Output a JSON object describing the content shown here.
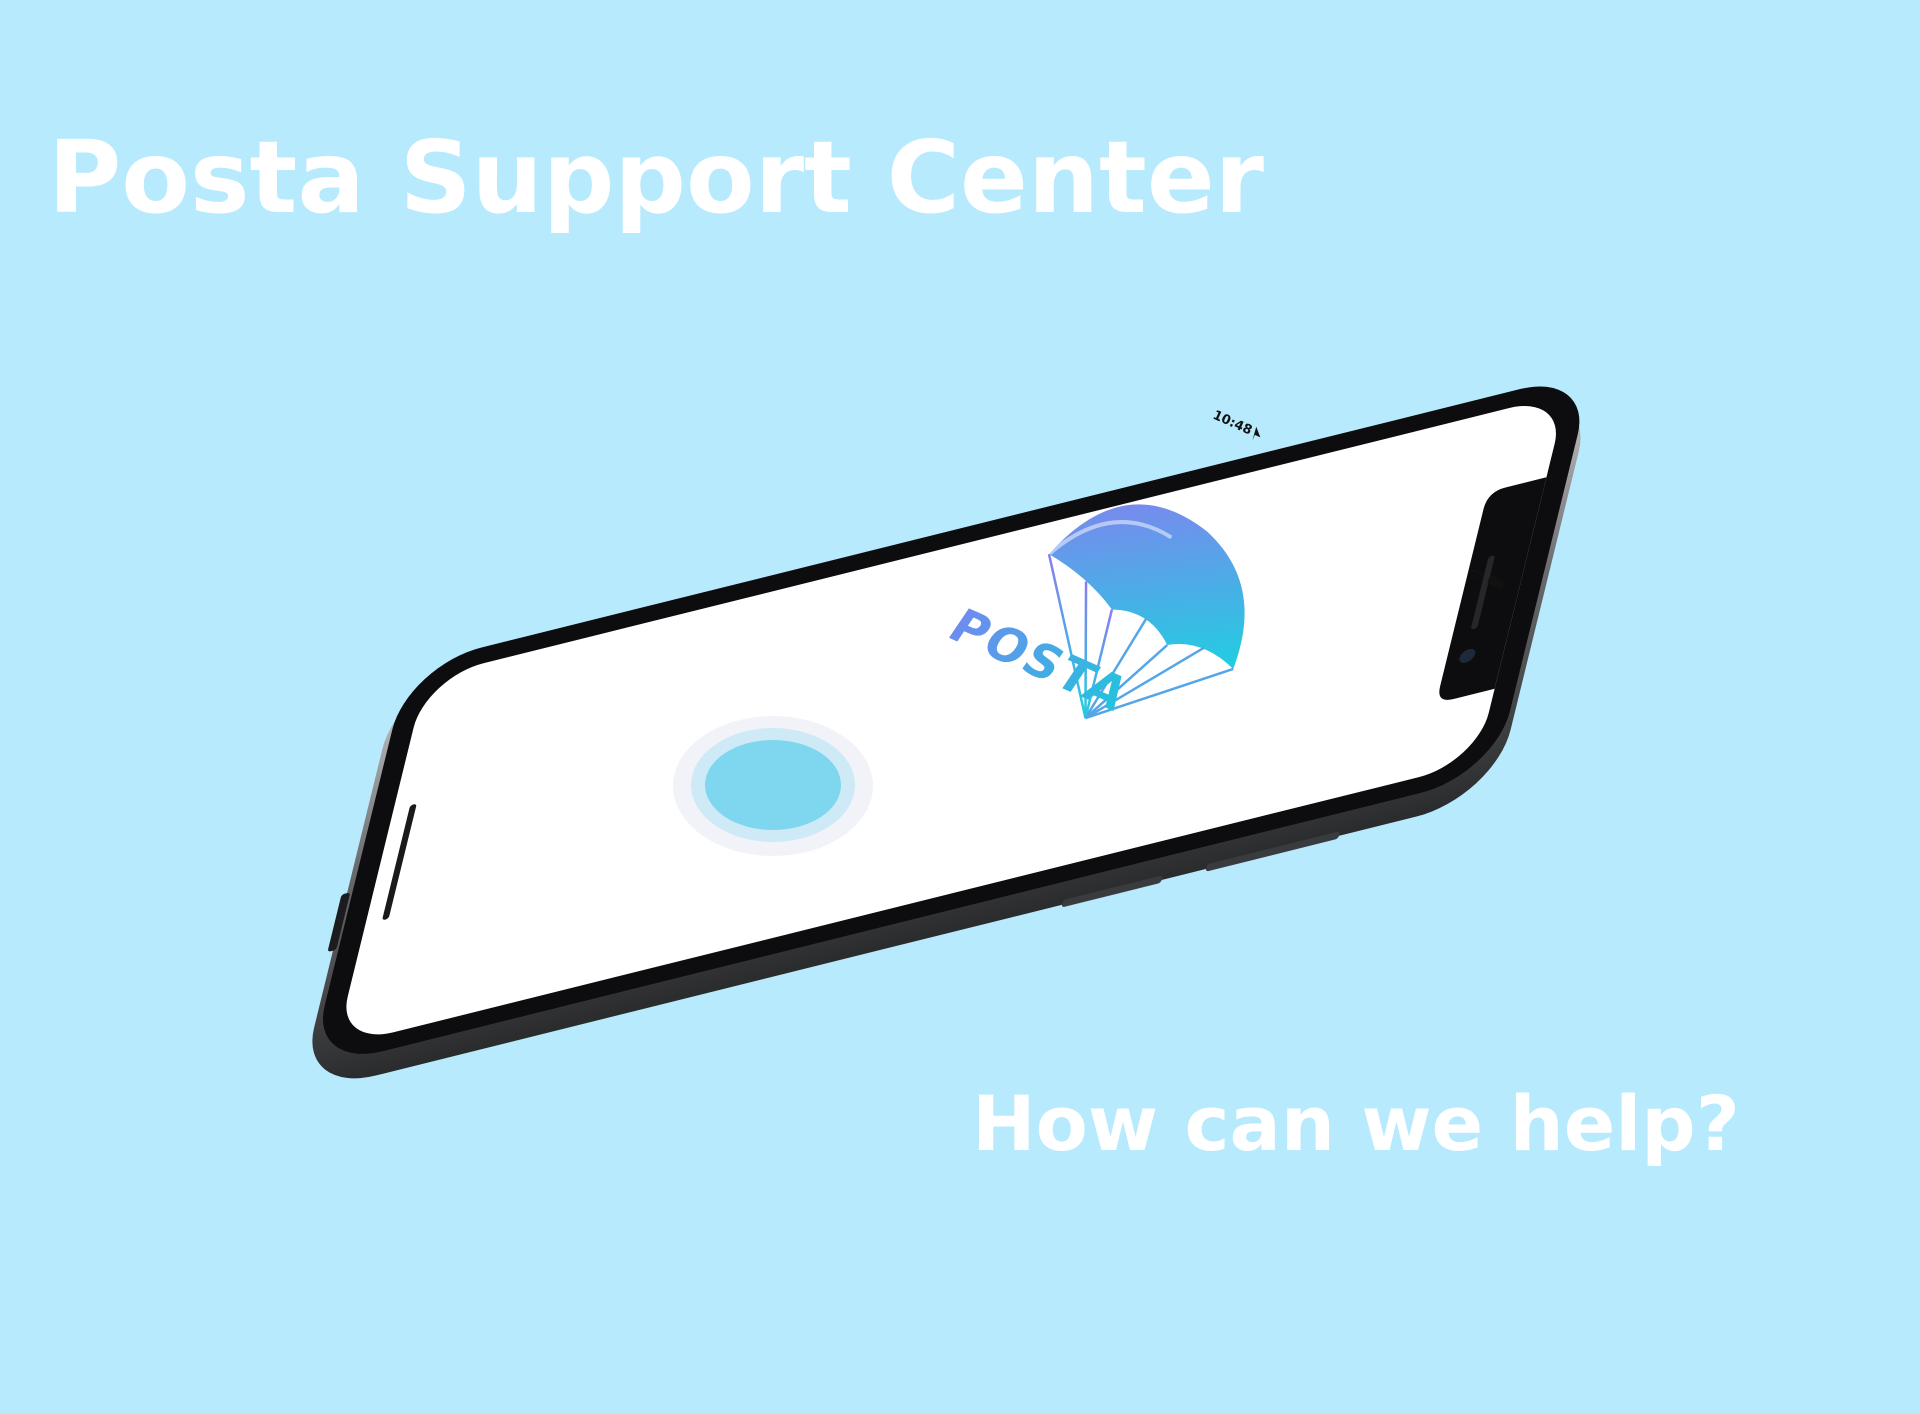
{
  "page": {
    "headline": "Posta Support Center",
    "tagline": "How can we help?"
  },
  "phone": {
    "status_bar": {
      "time": "10:48"
    },
    "app": {
      "logo_text": "POSTA"
    }
  },
  "colors": {
    "background": "#b7eafc",
    "text": "#ffffff",
    "logo_gradient_start": "#8a7cf0",
    "logo_gradient_end": "#1ed0e0",
    "record_button": "#7fd6ef",
    "record_button_ring": "#cdeaf6"
  },
  "icons": {
    "location": "location-arrow-icon",
    "wifi": "wifi-icon",
    "parachute": "parachute-logo-icon",
    "record": "voice-record-button"
  }
}
